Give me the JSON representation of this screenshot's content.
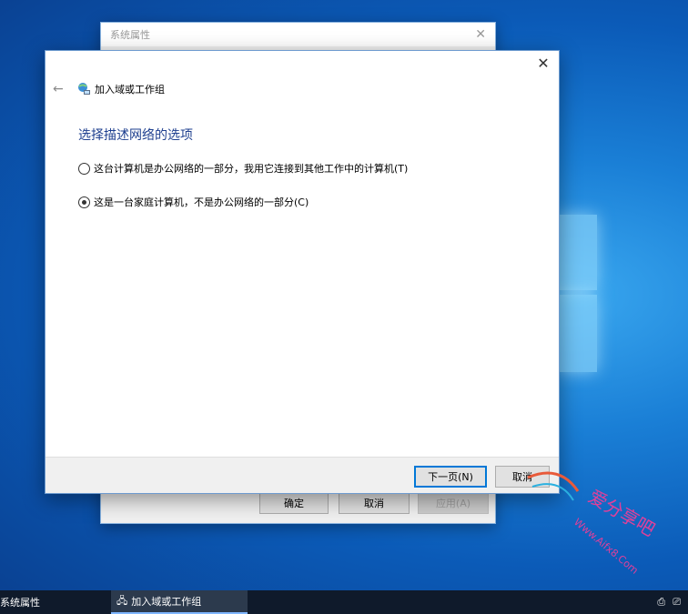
{
  "background_dialog": {
    "title": "系统属性",
    "buttons": {
      "ok": "确定",
      "cancel": "取消",
      "apply": "应用(A)"
    }
  },
  "wizard": {
    "title": "加入域或工作组",
    "heading": "选择描述网络的选项",
    "options": [
      {
        "label": "这台计算机是办公网络的一部分，我用它连接到其他工作中的计算机(T)",
        "selected": false
      },
      {
        "label": "这是一台家庭计算机，不是办公网络的一部分(C)",
        "selected": true
      }
    ],
    "buttons": {
      "next": "下一页(N)",
      "cancel": "取消"
    }
  },
  "taskbar": {
    "items": [
      {
        "label": "系统属性",
        "active": false
      },
      {
        "label": "加入域或工作组",
        "active": true
      }
    ]
  },
  "watermark": {
    "text": "爱分享吧",
    "url": "Www.Aifx8.Com"
  },
  "colors": {
    "accent": "#0078d7",
    "heading": "#1e3f8f",
    "desktop": "#0b5bb8"
  }
}
